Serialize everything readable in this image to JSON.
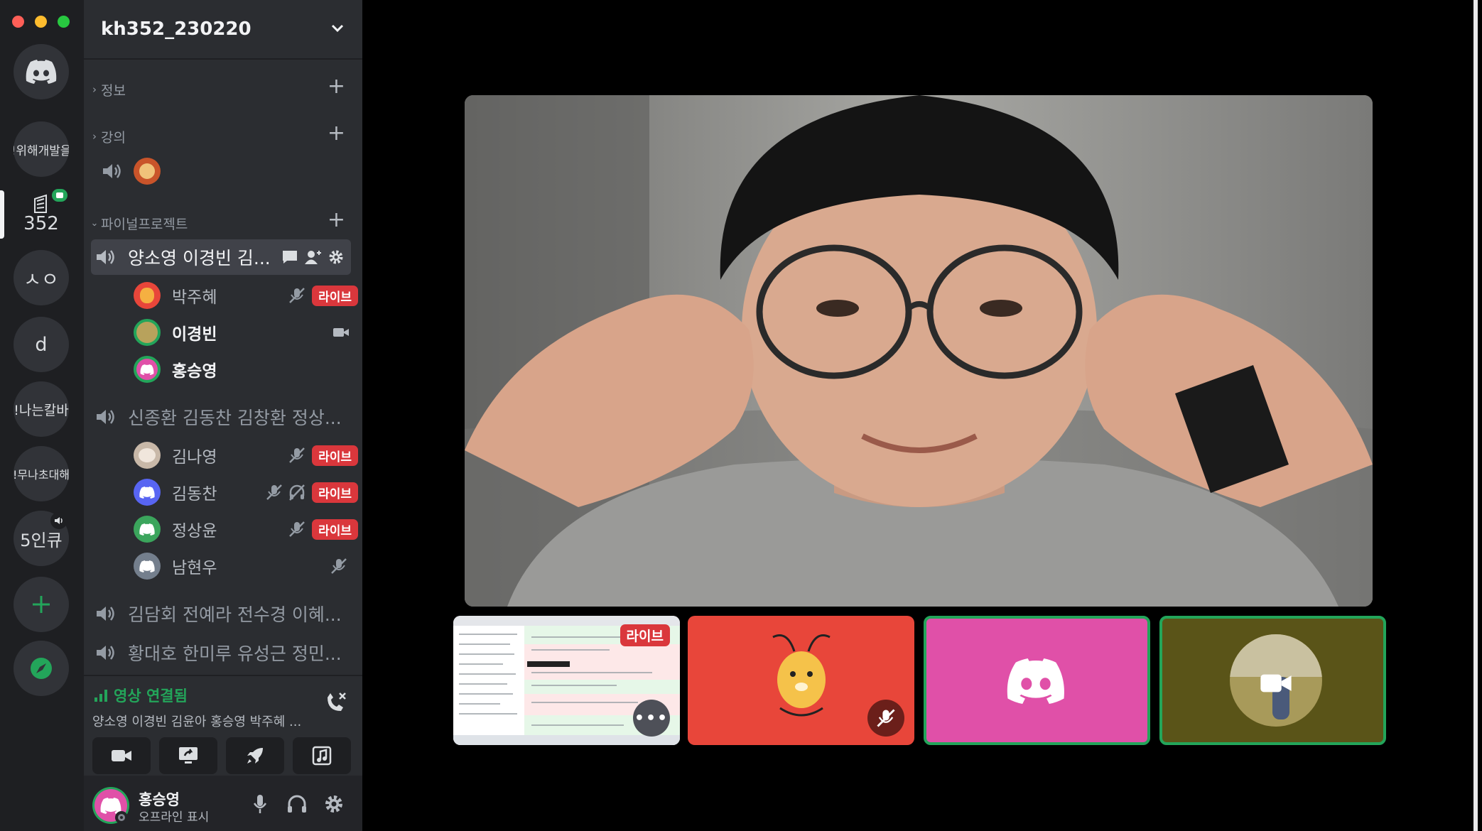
{
  "window": {
    "traffic_lights": [
      "#ff5f57",
      "#febc2e",
      "#28c840"
    ]
  },
  "rail": {
    "home_icon": "discord-logo-icon",
    "servers": [
      {
        "label": "!위해개발을"
      },
      {
        "label": "352",
        "badge_icon": "video-icon"
      },
      {
        "label": "ㅅㅇ"
      },
      {
        "label": "d"
      },
      {
        "label": "!나는칼바"
      },
      {
        "label": "!무나초대해"
      },
      {
        "label": "5인큐",
        "badge_icon": "speaker-icon"
      }
    ],
    "add_icon": "plus-icon",
    "explore_icon": "compass-icon"
  },
  "server": {
    "name": "kh352_230220",
    "categories": [
      {
        "name": "정보"
      },
      {
        "name": "강의"
      },
      {
        "name": "파이널프로젝트"
      }
    ],
    "channels": {
      "active": {
        "name": "양소영 이경빈 김...",
        "members": [
          {
            "name": "박주혜",
            "live_label": "라이브"
          },
          {
            "name": "이경빈"
          },
          {
            "name": "홍승영"
          }
        ]
      },
      "second": {
        "name": "신종환 김동찬 김창환 정상...",
        "members": [
          {
            "name": "김나영",
            "live_label": "라이브"
          },
          {
            "name": "김동찬",
            "live_label": "라이브"
          },
          {
            "name": "정상윤",
            "live_label": "라이브"
          },
          {
            "name": "남현우"
          }
        ]
      },
      "third": {
        "name": "김담회 전예라 전수경 이혜..."
      },
      "fourth": {
        "name": "황대호 한미루 유성근 정민..."
      }
    }
  },
  "voice_panel": {
    "status": "영상 연결됨",
    "members": "양소영 이경빈 김윤아 홍승영 박주혜 ..."
  },
  "user_panel": {
    "name": "홍승영",
    "status": "오프라인 표시"
  },
  "stage": {
    "tiles": [
      {
        "live_label": "라이브"
      },
      {},
      {},
      {}
    ]
  },
  "colors": {
    "accent_green": "#23a55a",
    "live_red": "#da373c",
    "blurple": "#5865f2",
    "tile_red": "#e8463a",
    "tile_pink": "#e050a8",
    "tile_olive": "#5a5418"
  }
}
